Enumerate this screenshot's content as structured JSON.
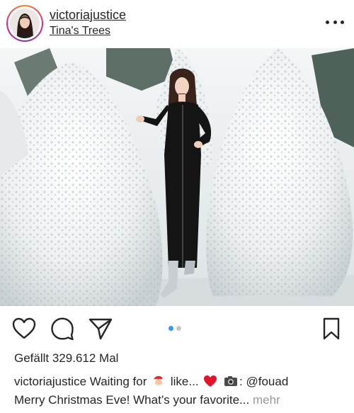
{
  "header": {
    "username": "victoriajustice",
    "location": "Tina's Trees"
  },
  "icons": {
    "more": "more-horizontal-icon",
    "like": "heart-outline-icon",
    "comment": "comment-icon",
    "share": "paper-plane-icon",
    "save": "bookmark-icon",
    "caption_emoji_1": "santa-emoji",
    "caption_emoji_2": "red-heart-emoji",
    "caption_emoji_3": "camera-emoji"
  },
  "carousel": {
    "total": 2,
    "active_index": 0,
    "active_color": "#3897f0",
    "inactive_color": "#c7c7c7"
  },
  "likes_text": "Gefällt 329.612 Mal",
  "caption": {
    "username": "victoriajustice",
    "part1": "Waiting for",
    "part2": "like...",
    "part3": ": @fouad",
    "line2": "Merry Christmas Eve! What’s your favorite...",
    "more_label": "mehr"
  }
}
